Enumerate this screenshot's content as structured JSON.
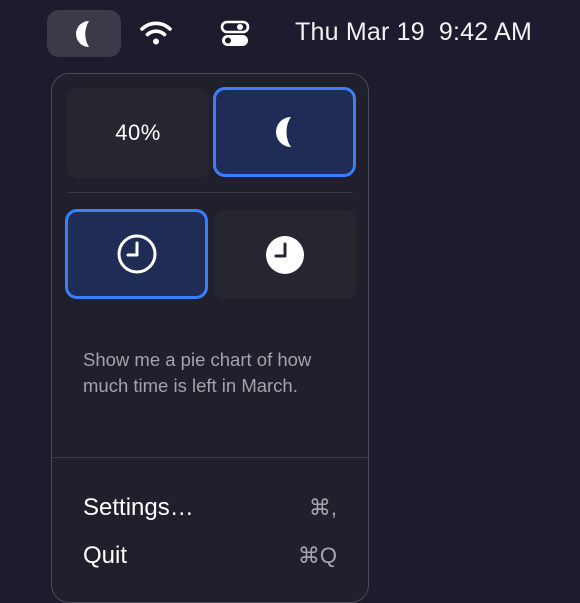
{
  "menubar": {
    "status_item_icon": "pie-half-icon",
    "wifi_icon": "wifi-icon",
    "control_center_icon": "control-center-icon",
    "date": "Thu Mar 19",
    "time": "9:42 AM"
  },
  "popover": {
    "display_mode": {
      "percent_option_label": "40%",
      "pie_option_icon": "pie-half-icon",
      "selected": "pie"
    },
    "clock_style": {
      "outline_option_icon": "clock-outline-icon",
      "filled_option_icon": "clock-filled-icon",
      "selected": "outline"
    },
    "prompt_text": "Show me a pie chart of how much time is left in March.",
    "menu": [
      {
        "label": "Settings…",
        "shortcut": "⌘,"
      },
      {
        "label": "Quit",
        "shortcut": "⌘Q"
      }
    ]
  },
  "colors": {
    "accent": "#3b7dff",
    "selected_fill": "#1f2d56",
    "background": "#1c1c2e",
    "popover_bg": "#20202c"
  }
}
